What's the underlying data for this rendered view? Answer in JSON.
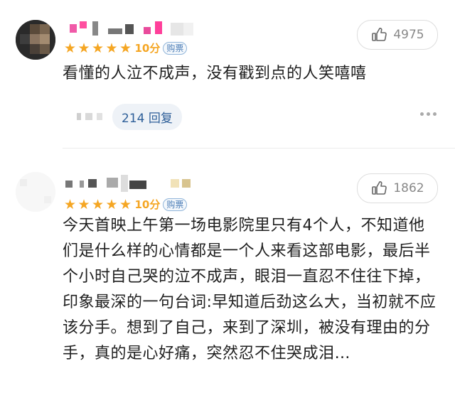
{
  "comments": [
    {
      "stars": 5,
      "score": "10分",
      "badge": "购票",
      "likes": "4975",
      "text": "看懂的人泣不成声，没有戳到点的人笑嘻嘻",
      "reply_label": "214 回复",
      "icons": {
        "like": "thumbs-up-icon",
        "more": "more-dots-icon"
      }
    },
    {
      "stars": 5,
      "score": "10分",
      "badge": "购票",
      "likes": "1862",
      "text": "今天首映上午第一场电影院里只有4个人，不知道他们是什么样的心情都是一个人来看这部电影，最后半个小时自己哭的泣不成声，眼泪一直忍不住往下掉，印象最深的一句台词:早知道后劲这么大，当初就不应该分手。想到了自己，来到了深圳，被没有理由的分手，真的是心好痛，突然忍不住哭成泪…",
      "icons": {
        "like": "thumbs-up-icon"
      }
    }
  ],
  "colors": {
    "star": "#f5a623",
    "badge": "#4e7fb8",
    "reply": "#2e5f99"
  }
}
